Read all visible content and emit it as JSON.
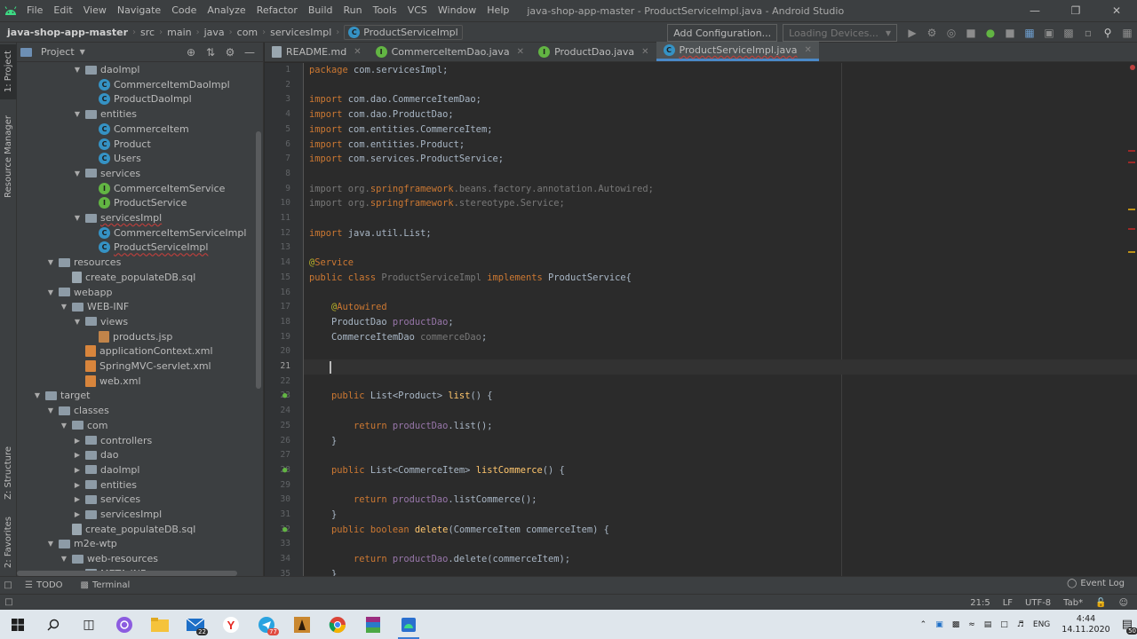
{
  "app": {
    "window_title": "java-shop-app-master - ProductServiceImpl.java - Android Studio",
    "menu": [
      "File",
      "Edit",
      "View",
      "Navigate",
      "Code",
      "Analyze",
      "Refactor",
      "Build",
      "Run",
      "Tools",
      "VCS",
      "Window",
      "Help"
    ]
  },
  "navbar": {
    "breadcrumb": [
      "java-shop-app-master",
      "src",
      "main",
      "java",
      "com",
      "servicesImpl",
      "ProductServiceImpl"
    ],
    "add_configuration": "Add Configuration...",
    "loading_devices": "Loading Devices..."
  },
  "left_strip": {
    "project": "1: Project",
    "resource_manager": "Resource Manager",
    "structure": "Z: Structure",
    "favorites": "2: Favorites"
  },
  "project_panel": {
    "title": "Project",
    "tree": [
      {
        "label": "daoImpl",
        "icon": "folder",
        "depth": 3,
        "expanded": true
      },
      {
        "label": "CommerceItemDaoImpl",
        "icon": "class",
        "depth": 4
      },
      {
        "label": "ProductDaoImpl",
        "icon": "class",
        "depth": 4
      },
      {
        "label": "entities",
        "icon": "folder",
        "depth": 3,
        "expanded": true
      },
      {
        "label": "CommerceItem",
        "icon": "class",
        "depth": 4
      },
      {
        "label": "Product",
        "icon": "class",
        "depth": 4
      },
      {
        "label": "Users",
        "icon": "class",
        "depth": 4
      },
      {
        "label": "services",
        "icon": "folder",
        "depth": 3,
        "expanded": true
      },
      {
        "label": "CommerceItemService",
        "icon": "iface",
        "depth": 4
      },
      {
        "label": "ProductService",
        "icon": "iface",
        "depth": 4
      },
      {
        "label": "servicesImpl",
        "icon": "folder",
        "depth": 3,
        "expanded": true,
        "error": true
      },
      {
        "label": "CommerceItemServiceImpl",
        "icon": "class",
        "depth": 4
      },
      {
        "label": "ProductServiceImpl",
        "icon": "class",
        "depth": 4,
        "error": true
      },
      {
        "label": "resources",
        "icon": "folder",
        "depth": 1,
        "expanded": true
      },
      {
        "label": "create_populateDB.sql",
        "icon": "file",
        "depth": 2
      },
      {
        "label": "webapp",
        "icon": "folder",
        "depth": 1,
        "expanded": true
      },
      {
        "label": "WEB-INF",
        "icon": "folder",
        "depth": 2,
        "expanded": true
      },
      {
        "label": "views",
        "icon": "folder",
        "depth": 3,
        "expanded": true
      },
      {
        "label": "products.jsp",
        "icon": "jsp",
        "depth": 4
      },
      {
        "label": "applicationContext.xml",
        "icon": "xml",
        "depth": 3
      },
      {
        "label": "SpringMVC-servlet.xml",
        "icon": "xml",
        "depth": 3
      },
      {
        "label": "web.xml",
        "icon": "xml",
        "depth": 3
      },
      {
        "label": "target",
        "icon": "folder",
        "depth": 0,
        "expanded": true
      },
      {
        "label": "classes",
        "icon": "folder",
        "depth": 1,
        "expanded": true
      },
      {
        "label": "com",
        "icon": "folder",
        "depth": 2,
        "expanded": true
      },
      {
        "label": "controllers",
        "icon": "folder",
        "depth": 3,
        "expanded": false
      },
      {
        "label": "dao",
        "icon": "folder",
        "depth": 3,
        "expanded": false
      },
      {
        "label": "daoImpl",
        "icon": "folder",
        "depth": 3,
        "expanded": false
      },
      {
        "label": "entities",
        "icon": "folder",
        "depth": 3,
        "expanded": false
      },
      {
        "label": "services",
        "icon": "folder",
        "depth": 3,
        "expanded": false
      },
      {
        "label": "servicesImpl",
        "icon": "folder",
        "depth": 3,
        "expanded": false
      },
      {
        "label": "create_populateDB.sql",
        "icon": "file",
        "depth": 2
      },
      {
        "label": "m2e-wtp",
        "icon": "folder",
        "depth": 1,
        "expanded": true
      },
      {
        "label": "web-resources",
        "icon": "folder",
        "depth": 2,
        "expanded": true
      },
      {
        "label": "META-INF",
        "icon": "folder",
        "depth": 3,
        "expanded": true
      }
    ]
  },
  "editor_tabs": [
    {
      "label": "README.md",
      "icon": "file"
    },
    {
      "label": "CommerceItemDao.java",
      "icon": "iface"
    },
    {
      "label": "ProductDao.java",
      "icon": "iface"
    },
    {
      "label": "ProductServiceImpl.java",
      "icon": "class",
      "active": true
    }
  ],
  "editor": {
    "current_line": 21,
    "lines": [
      {
        "n": 1,
        "html": "<span class='kw'>package</span> com.servicesImpl;"
      },
      {
        "n": 2,
        "html": ""
      },
      {
        "n": 3,
        "html": "<span class='kw'>import</span> com.dao.CommerceItemDao;"
      },
      {
        "n": 4,
        "html": "<span class='kw'>import</span> com.dao.ProductDao;"
      },
      {
        "n": 5,
        "html": "<span class='kw'>import</span> com.entities.CommerceItem;"
      },
      {
        "n": 6,
        "html": "<span class='kw'>import</span> com.entities.Product;"
      },
      {
        "n": 7,
        "html": "<span class='kw'>import</span> com.services.ProductService;"
      },
      {
        "n": 8,
        "html": ""
      },
      {
        "n": 9,
        "html": "<span class='gray'>import org.<span class='kw'>springframework</span>.beans.factory.annotation.Autowired;</span>"
      },
      {
        "n": 10,
        "html": "<span class='gray'>import org.<span class='kw'>springframework</span>.stereotype.Service;</span>"
      },
      {
        "n": 11,
        "html": ""
      },
      {
        "n": 12,
        "html": "<span class='kw'>import</span> java.util.List;"
      },
      {
        "n": 13,
        "html": ""
      },
      {
        "n": 14,
        "html": "<span class='ann'>@</span><span class='kw'>Service</span>"
      },
      {
        "n": 15,
        "html": "<span class='kw'>public class</span> <span class='gray'>ProductServiceImpl</span> <span class='kw'>implements</span> ProductService{"
      },
      {
        "n": 16,
        "html": ""
      },
      {
        "n": 17,
        "html": "    <span class='ann'>@</span><span class='kw'>Autowired</span>"
      },
      {
        "n": 18,
        "html": "    ProductDao <span class='fld'>productDao</span>;"
      },
      {
        "n": 19,
        "html": "    CommerceItemDao <span class='gray'>commerceDao</span>;"
      },
      {
        "n": 20,
        "html": ""
      },
      {
        "n": 21,
        "html": ""
      },
      {
        "n": 22,
        "html": ""
      },
      {
        "n": 23,
        "html": "    <span class='kw'>public</span> List&lt;Product&gt; <span class='fn'>list</span>() {",
        "mark": true
      },
      {
        "n": 24,
        "html": ""
      },
      {
        "n": 25,
        "html": "        <span class='kw'>return</span> <span class='fld'>productDao</span>.list();"
      },
      {
        "n": 26,
        "html": "    }"
      },
      {
        "n": 27,
        "html": ""
      },
      {
        "n": 28,
        "html": "    <span class='kw'>public</span> List&lt;CommerceItem&gt; <span class='fn'>listCommerce</span>() {",
        "mark": true
      },
      {
        "n": 29,
        "html": ""
      },
      {
        "n": 30,
        "html": "        <span class='kw'>return</span> <span class='fld'>productDao</span>.listCommerce();"
      },
      {
        "n": 31,
        "html": "    }"
      },
      {
        "n": 32,
        "html": "    <span class='kw'>public boolean</span> <span class='fn'>delete</span>(CommerceItem commerceItem) {",
        "mark": true
      },
      {
        "n": 33,
        "html": ""
      },
      {
        "n": 34,
        "html": "        <span class='kw'>return</span> <span class='fld'>productDao</span>.delete(commerceItem);"
      },
      {
        "n": 35,
        "html": "    }"
      }
    ]
  },
  "bottom": {
    "todo": "TODO",
    "terminal": "Terminal",
    "event_log": "Event Log"
  },
  "status": {
    "position": "21:5",
    "line_sep": "LF",
    "encoding": "UTF-8",
    "indent": "Tab*"
  },
  "taskbar": {
    "mail_badge": "22",
    "telegram_badge": "77",
    "lang": "ENG",
    "time": "4:44",
    "date": "14.11.2020",
    "notif_badge": "50"
  }
}
